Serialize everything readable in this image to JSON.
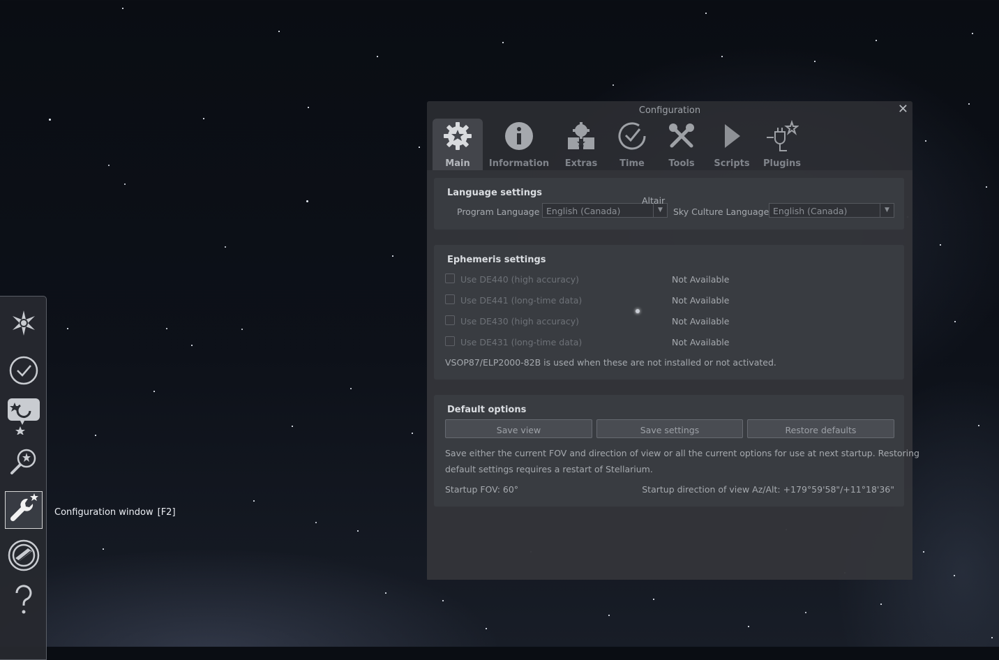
{
  "tooltip": {
    "text": "Configuration window",
    "shortcut": "[F2]"
  },
  "left_toolbar": {
    "items": [
      {
        "name": "location-icon"
      },
      {
        "name": "date-time-icon"
      },
      {
        "name": "sky-viewing-options-icon"
      },
      {
        "name": "search-icon"
      },
      {
        "name": "configuration-icon",
        "active": true
      },
      {
        "name": "astronomical-calculations-icon"
      },
      {
        "name": "help-icon"
      }
    ]
  },
  "sky": {
    "star_label": "Altair"
  },
  "dialog": {
    "title": "Configuration",
    "close": "✕",
    "tabs": [
      {
        "label": "Main",
        "active": true
      },
      {
        "label": "Information"
      },
      {
        "label": "Extras"
      },
      {
        "label": "Time"
      },
      {
        "label": "Tools"
      },
      {
        "label": "Scripts"
      },
      {
        "label": "Plugins"
      }
    ],
    "language": {
      "title": "Language settings",
      "program_label": "Program Language",
      "program_value": "English (Canada)",
      "sky_label": "Sky Culture Language",
      "sky_value": "English (Canada)"
    },
    "ephemeris": {
      "title": "Ephemeris settings",
      "items": [
        {
          "label": "Use DE440 (high accuracy)",
          "status": "Not Available"
        },
        {
          "label": "Use DE441 (long-time data)",
          "status": "Not Available"
        },
        {
          "label": "Use DE430 (high accuracy)",
          "status": "Not Available"
        },
        {
          "label": "Use DE431 (long-time data)",
          "status": "Not Available"
        }
      ],
      "note": "VSOP87/ELP2000-82B is used when these are not installed or not activated."
    },
    "defaults": {
      "title": "Default options",
      "save_view": "Save view",
      "save_settings": "Save settings",
      "restore_defaults": "Restore defaults",
      "description_line1": "Save either the current FOV and direction of view or all the current options for use at next startup. Restoring",
      "description_line2": "default settings requires a restart of Stellarium.",
      "startup_fov": "Startup FOV: 60°",
      "startup_direction": "Startup direction of view Az/Alt: +179°59'58\"/+11°18'36\""
    }
  }
}
